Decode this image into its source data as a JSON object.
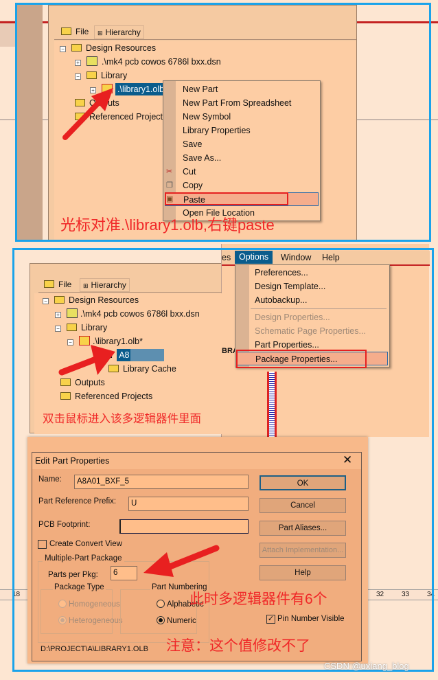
{
  "top": {
    "tabs": [
      {
        "label": "File",
        "icon": "folder-icon"
      },
      {
        "label": "Hierarchy",
        "icon": "hierarchy-icon"
      }
    ],
    "tree": [
      "Design Resources",
      ".\\mk4 pcb cowos 6786l bxx.dsn",
      "Library",
      ".\\library1.olb",
      "Outputs",
      "Referenced Projects"
    ],
    "context_menu": [
      "New Part",
      "New Part From Spreadsheet",
      "New Symbol",
      "Library Properties",
      "Save",
      "Save As...",
      "Cut",
      "Copy",
      "Paste",
      "Open File Location"
    ],
    "highlighted": "Paste",
    "annotation": "光标对准.\\library1.olb,右键paste"
  },
  "middle": {
    "tabs": [
      {
        "label": "File"
      },
      {
        "label": "Hierarchy"
      }
    ],
    "tree": [
      "Design Resources",
      ".\\mk4 pcb cowos 6786l bxx.dsn",
      "Library",
      ".\\library1.olb*",
      "A8",
      "Library Cache",
      "Outputs",
      "Referenced Projects"
    ],
    "annotation": "双击鼠标进入该多逻辑器件里面",
    "menubar": [
      "es",
      "Options",
      "Window",
      "Help"
    ],
    "options_menu": {
      "enabled_top": [
        "Preferences...",
        "Design Template...",
        "Autobackup..."
      ],
      "disabled": [
        "Design Properties...",
        "Schematic Page Properties..."
      ],
      "enabled_bottom": [
        "Part Properties...",
        "Package Properties..."
      ]
    },
    "partial_label": "BRA",
    "highlighted": "Package Properties..."
  },
  "dialog": {
    "title": "Edit Part Properties",
    "name_label": "Name:",
    "name_value": "A8A01_BXF_5",
    "prefix_label": "Part Reference Prefix:",
    "prefix_value": "U",
    "footprint_label": "PCB Footprint:",
    "footprint_value": "",
    "convert_label": "Create Convert View",
    "convert_checked": false,
    "multi_label": "Multiple-Part Package",
    "parts_label": "Parts per Pkg:",
    "parts_value": "6",
    "pkg_type_label": "Package Type",
    "homogeneous": "Homogeneous",
    "heterogeneous": "Heterogeneous",
    "numbering_label": "Part Numbering",
    "alphabetic": "Alphabetic",
    "numeric": "Numeric",
    "ok": "OK",
    "cancel": "Cancel",
    "aliases": "Part Aliases...",
    "attach": "Attach Implementation...",
    "help": "Help",
    "pin_visible_label": "Pin Number Visible",
    "pin_visible_checked": true,
    "path": "D:\\PROJECT\\A\\LIBRARY1.OLB",
    "annotation1": "此时多逻辑器件有6个",
    "annotation2": "注意：这个值修改不了"
  },
  "ruler": {
    "left": "18",
    "right": [
      "32",
      "33",
      "34"
    ]
  },
  "watermark": "CSDN @uxiang_blog",
  "colors": {
    "frame": "#1aa3ea",
    "annotation": "#f02828",
    "selection": "#0a5c8c"
  }
}
